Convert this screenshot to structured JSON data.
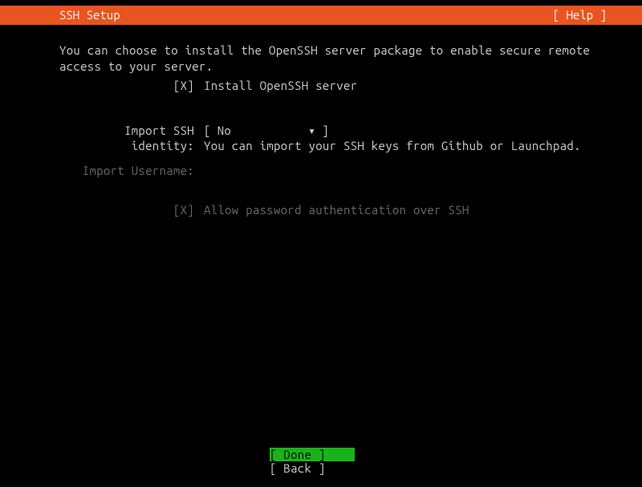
{
  "header": {
    "title": "SSH Setup",
    "help": "[ Help ]"
  },
  "intro": {
    "line1": "You can choose to install the OpenSSH server package to enable secure remote",
    "line2": "access to your server."
  },
  "install": {
    "checkbox": "[X]",
    "label": "Install OpenSSH server"
  },
  "import_identity": {
    "label": "Import SSH identity:",
    "bracket_open": "[",
    "value": "No",
    "arrow": "▾",
    "bracket_close": "]",
    "hint": "You can import your SSH keys from Github or Launchpad."
  },
  "import_username": {
    "label": "Import Username:"
  },
  "allow_password": {
    "checkbox": "[X]",
    "label": "Allow password authentication over SSH"
  },
  "footer": {
    "done": "[ Done        ]",
    "back": "[ Back        ]"
  }
}
